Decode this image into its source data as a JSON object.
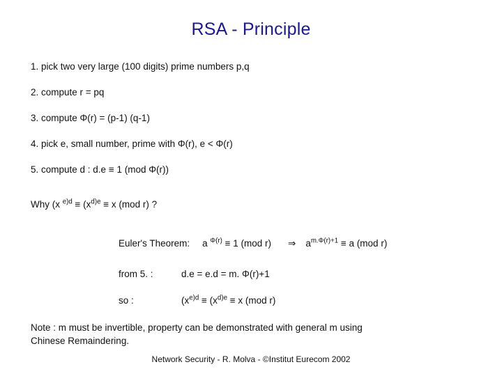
{
  "slide": {
    "title": "RSA - Principle",
    "steps": [
      "1. pick two very large (100 digits) prime numbers p,q",
      "2. compute r = pq",
      "3. compute Φ(r) = (p-1) (q-1)",
      "4. pick e, small number, prime with Φ(r), e < Φ(r)",
      "5. compute d :  d.e ≡  1 (mod Φ(r))"
    ],
    "why": {
      "prefix": "Why (x ",
      "sup1": "e)d",
      "mid": " ≡ (x",
      "sup2": "d)e",
      "suffix": " ≡ x (mod r)   ?"
    },
    "euler": {
      "label": "Euler's Theorem:",
      "expr1_base": "a ",
      "expr1_sup": "Φ(r)",
      "expr1_rest": " ≡ 1 (mod r)",
      "arrow": "⇒",
      "expr2_base": "a",
      "expr2_sup": "m.Φ(r)+1",
      "expr2_rest": " ≡ a (mod r)"
    },
    "from5": {
      "label": "from 5. :",
      "value": "d.e = e.d = m. Φ(r)+1"
    },
    "so": {
      "label": "so :",
      "prefix": "(x",
      "sup1": "e)d",
      "mid": " ≡ (x",
      "sup2": "d)e",
      "suffix": " ≡ x  (mod r)"
    },
    "note_line1": "Note : m must be invertible, property can be demonstrated with general m using",
    "note_line2": "Chinese Remaindering.",
    "footer": "Network Security - R. Molva - ©Institut Eurecom 2002"
  }
}
